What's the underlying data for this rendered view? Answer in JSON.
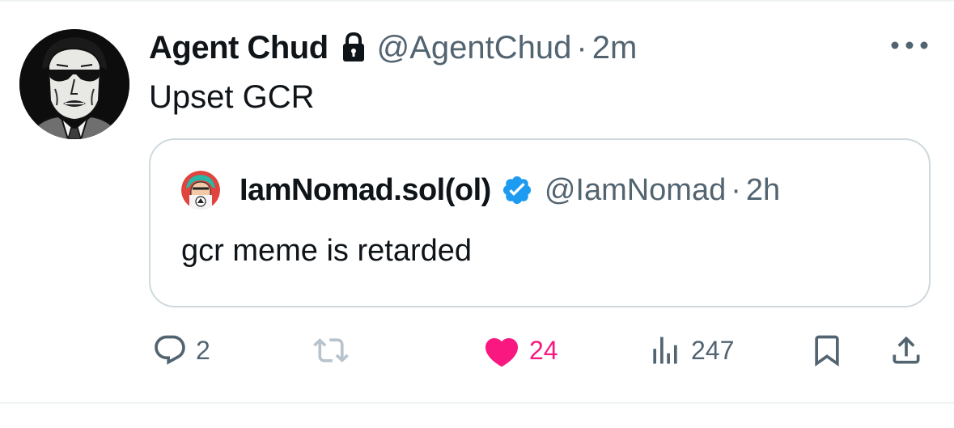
{
  "tweet": {
    "display_name": "Agent Chud",
    "handle": "@AgentChud",
    "separator": "·",
    "time": "2m",
    "text": "Upset GCR"
  },
  "quoted_tweet": {
    "display_name": "IamNomad.sol(ol)",
    "handle": "@IamNomad",
    "separator": "·",
    "time": "2h",
    "text": "gcr meme is retarded"
  },
  "actions": {
    "replies": "2",
    "reposts": "",
    "likes": "24",
    "views": "247"
  },
  "icons": {
    "protected": "lock-icon",
    "verified": "verified-badge-icon",
    "reply": "speech-bubble-icon",
    "repost": "repost-arrows-icon",
    "like": "heart-icon",
    "views": "bar-chart-icon",
    "bookmark": "bookmark-icon",
    "share": "share-upload-icon",
    "more": "ellipsis-icon"
  },
  "colors": {
    "text_primary": "#0f1419",
    "text_secondary": "#536471",
    "like_pink": "#f91880",
    "verified_blue": "#1d9bf0",
    "border": "#cfd9de",
    "repost_disabled": "#b8c3cc"
  }
}
